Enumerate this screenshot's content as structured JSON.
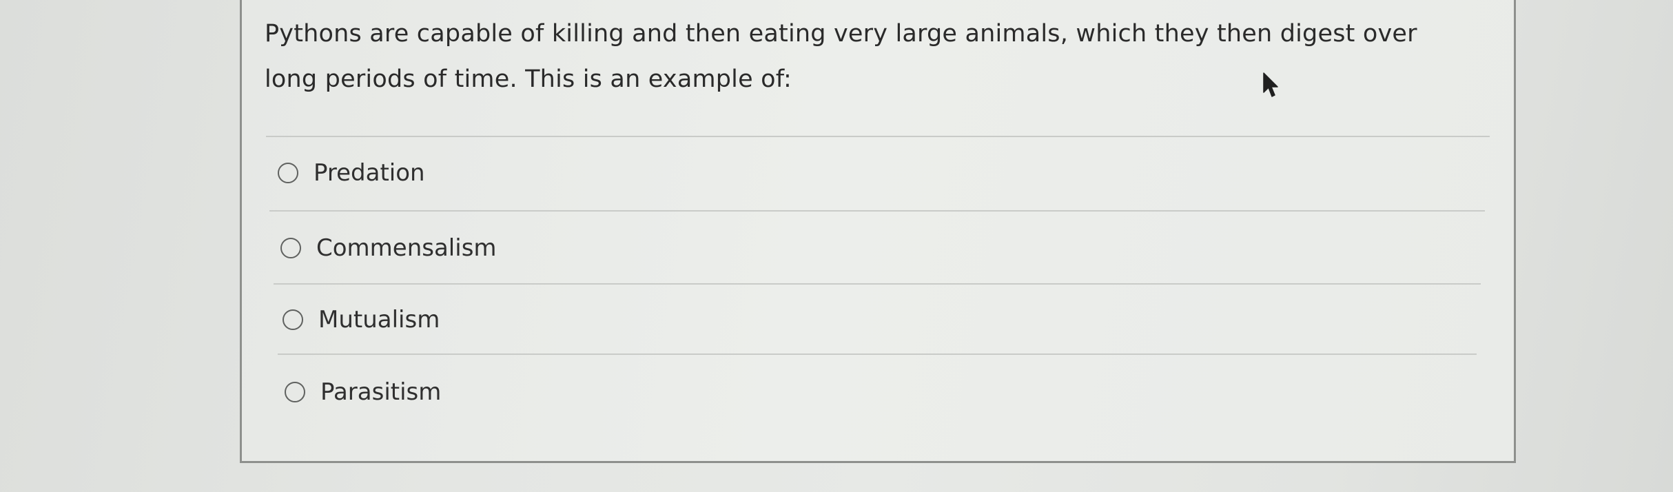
{
  "question": {
    "text": "Pythons are capable of killing and then eating very large animals, which they then digest over long periods of time. This is an example of:"
  },
  "options": [
    {
      "label": "Predation",
      "selected": false
    },
    {
      "label": "Commensalism",
      "selected": false
    },
    {
      "label": "Mutualism",
      "selected": false
    },
    {
      "label": "Parasitism",
      "selected": false
    }
  ],
  "colors": {
    "card_border": "#8e908d",
    "divider": "#c9cbc8",
    "radio_border": "#5f615f",
    "text": "#2e2e2e"
  },
  "icons": {
    "cursor": "mouse-pointer-icon",
    "radio": "radio-unchecked-icon"
  }
}
